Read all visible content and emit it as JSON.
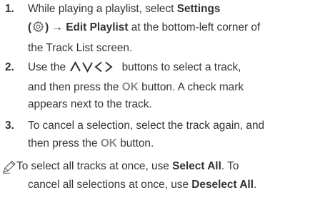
{
  "steps": [
    {
      "number": "1.",
      "pre": "While playing a playlist, select ",
      "settings": "Settings",
      "paren_open": "(",
      "paren_close": ")",
      "arrow": "→",
      "edit": "Edit Playlist",
      "post1": " at the bottom-left corner of",
      "line3": "the Track List screen."
    },
    {
      "number": "2.",
      "l1_pre": "Use the ",
      "l1_post": " buttons to select a track,",
      "l2_pre": "and then press the ",
      "ok": "OK",
      "l2_post": " button. A check mark",
      "l3": "appears next to the track."
    },
    {
      "number": "3.",
      "l1": "To cancel a selection, select the track again, and",
      "l2_pre": "then press the ",
      "ok": "OK",
      "l2_post": " button."
    }
  ],
  "note": {
    "l1_pre": "To select all tracks at once, use ",
    "select_all": "Select All",
    "l1_post": ". To",
    "l2_pre": "cancel all selections at once, use ",
    "deselect_all": "Deselect All",
    "l2_post": "."
  },
  "icons": {
    "gear": "gear-icon",
    "arrows": "direction-arrows-icon",
    "note": "note-pencil-icon"
  }
}
